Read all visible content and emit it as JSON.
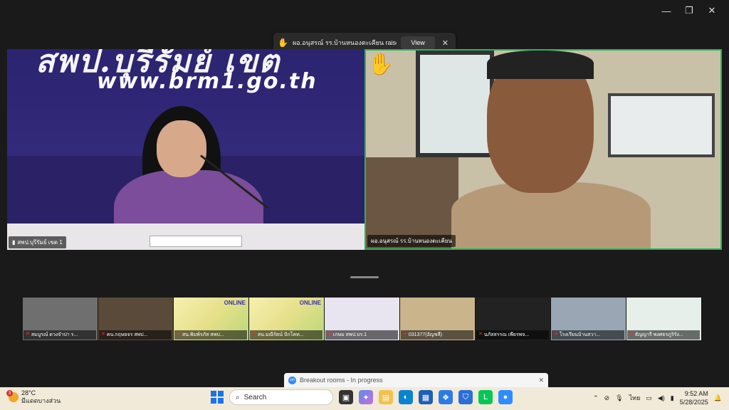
{
  "window": {
    "minimize": "—",
    "maximize": "❐",
    "close": "✕"
  },
  "notification": {
    "hand": "✋",
    "text": "ผอ.อนุสรณ์ รร.บ้านหนองตะเคียน raised hand",
    "view_label": "View",
    "close": "✕"
  },
  "main_left": {
    "banner_big": "สพป.บุรีรัมย์ เขต",
    "banner_url": "www.brm1.go.th",
    "label": "สพป.บุรีรัมย์ เขต 1"
  },
  "main_right": {
    "label": "ผอ.อนุสรณ์ รร.บ้านหนองตะเคียน",
    "raised_hand": "✋"
  },
  "thumbnails": [
    {
      "label": "สมบูรณ์ ดวงจำปา ร...",
      "muted": true,
      "bg": "#6f6f6f"
    },
    {
      "label": "คน.กฤษยจร สพป...",
      "muted": true,
      "bg": "#5a4a3a"
    },
    {
      "label": "สน.พิมพ์รภัส สพป...",
      "muted": true,
      "bg": "slide"
    },
    {
      "label": "สน.มณีรัตน์ ปักโคท...",
      "muted": true,
      "bg": "slide"
    },
    {
      "label": "เกษม สพป.บร.1",
      "muted": true,
      "bg": "#e8e4f0"
    },
    {
      "label": "031377(อัญชลี)",
      "muted": true,
      "bg": "#c9b48c"
    },
    {
      "label": "นภัสสรรณ เพียรพจ...",
      "muted": true,
      "bg": "#222"
    },
    {
      "label": "โรงเรียนบ้านสวา...",
      "muted": true,
      "bg": "#9aa6b4"
    },
    {
      "label": "ธัญญารี พงศธรภูริรัง...",
      "muted": true,
      "bg": "#e6efe9"
    }
  ],
  "slide_text": "ONLINE",
  "breakout": {
    "text": "Breakout rooms - In progress",
    "close": "✕",
    "app_icon": "zoom"
  },
  "taskbar": {
    "weather_temp": "28°C",
    "weather_desc": "มีแดดบางส่วน",
    "weather_badge": "3",
    "search_placeholder": "Search",
    "lang": "ไทย",
    "time": "9:52 AM",
    "date": "5/28/2025"
  },
  "colors": {
    "active_speaker_border": "#29b45a",
    "app_bg": "#1a1a1a",
    "taskbar_bg": "#f1ead9"
  }
}
